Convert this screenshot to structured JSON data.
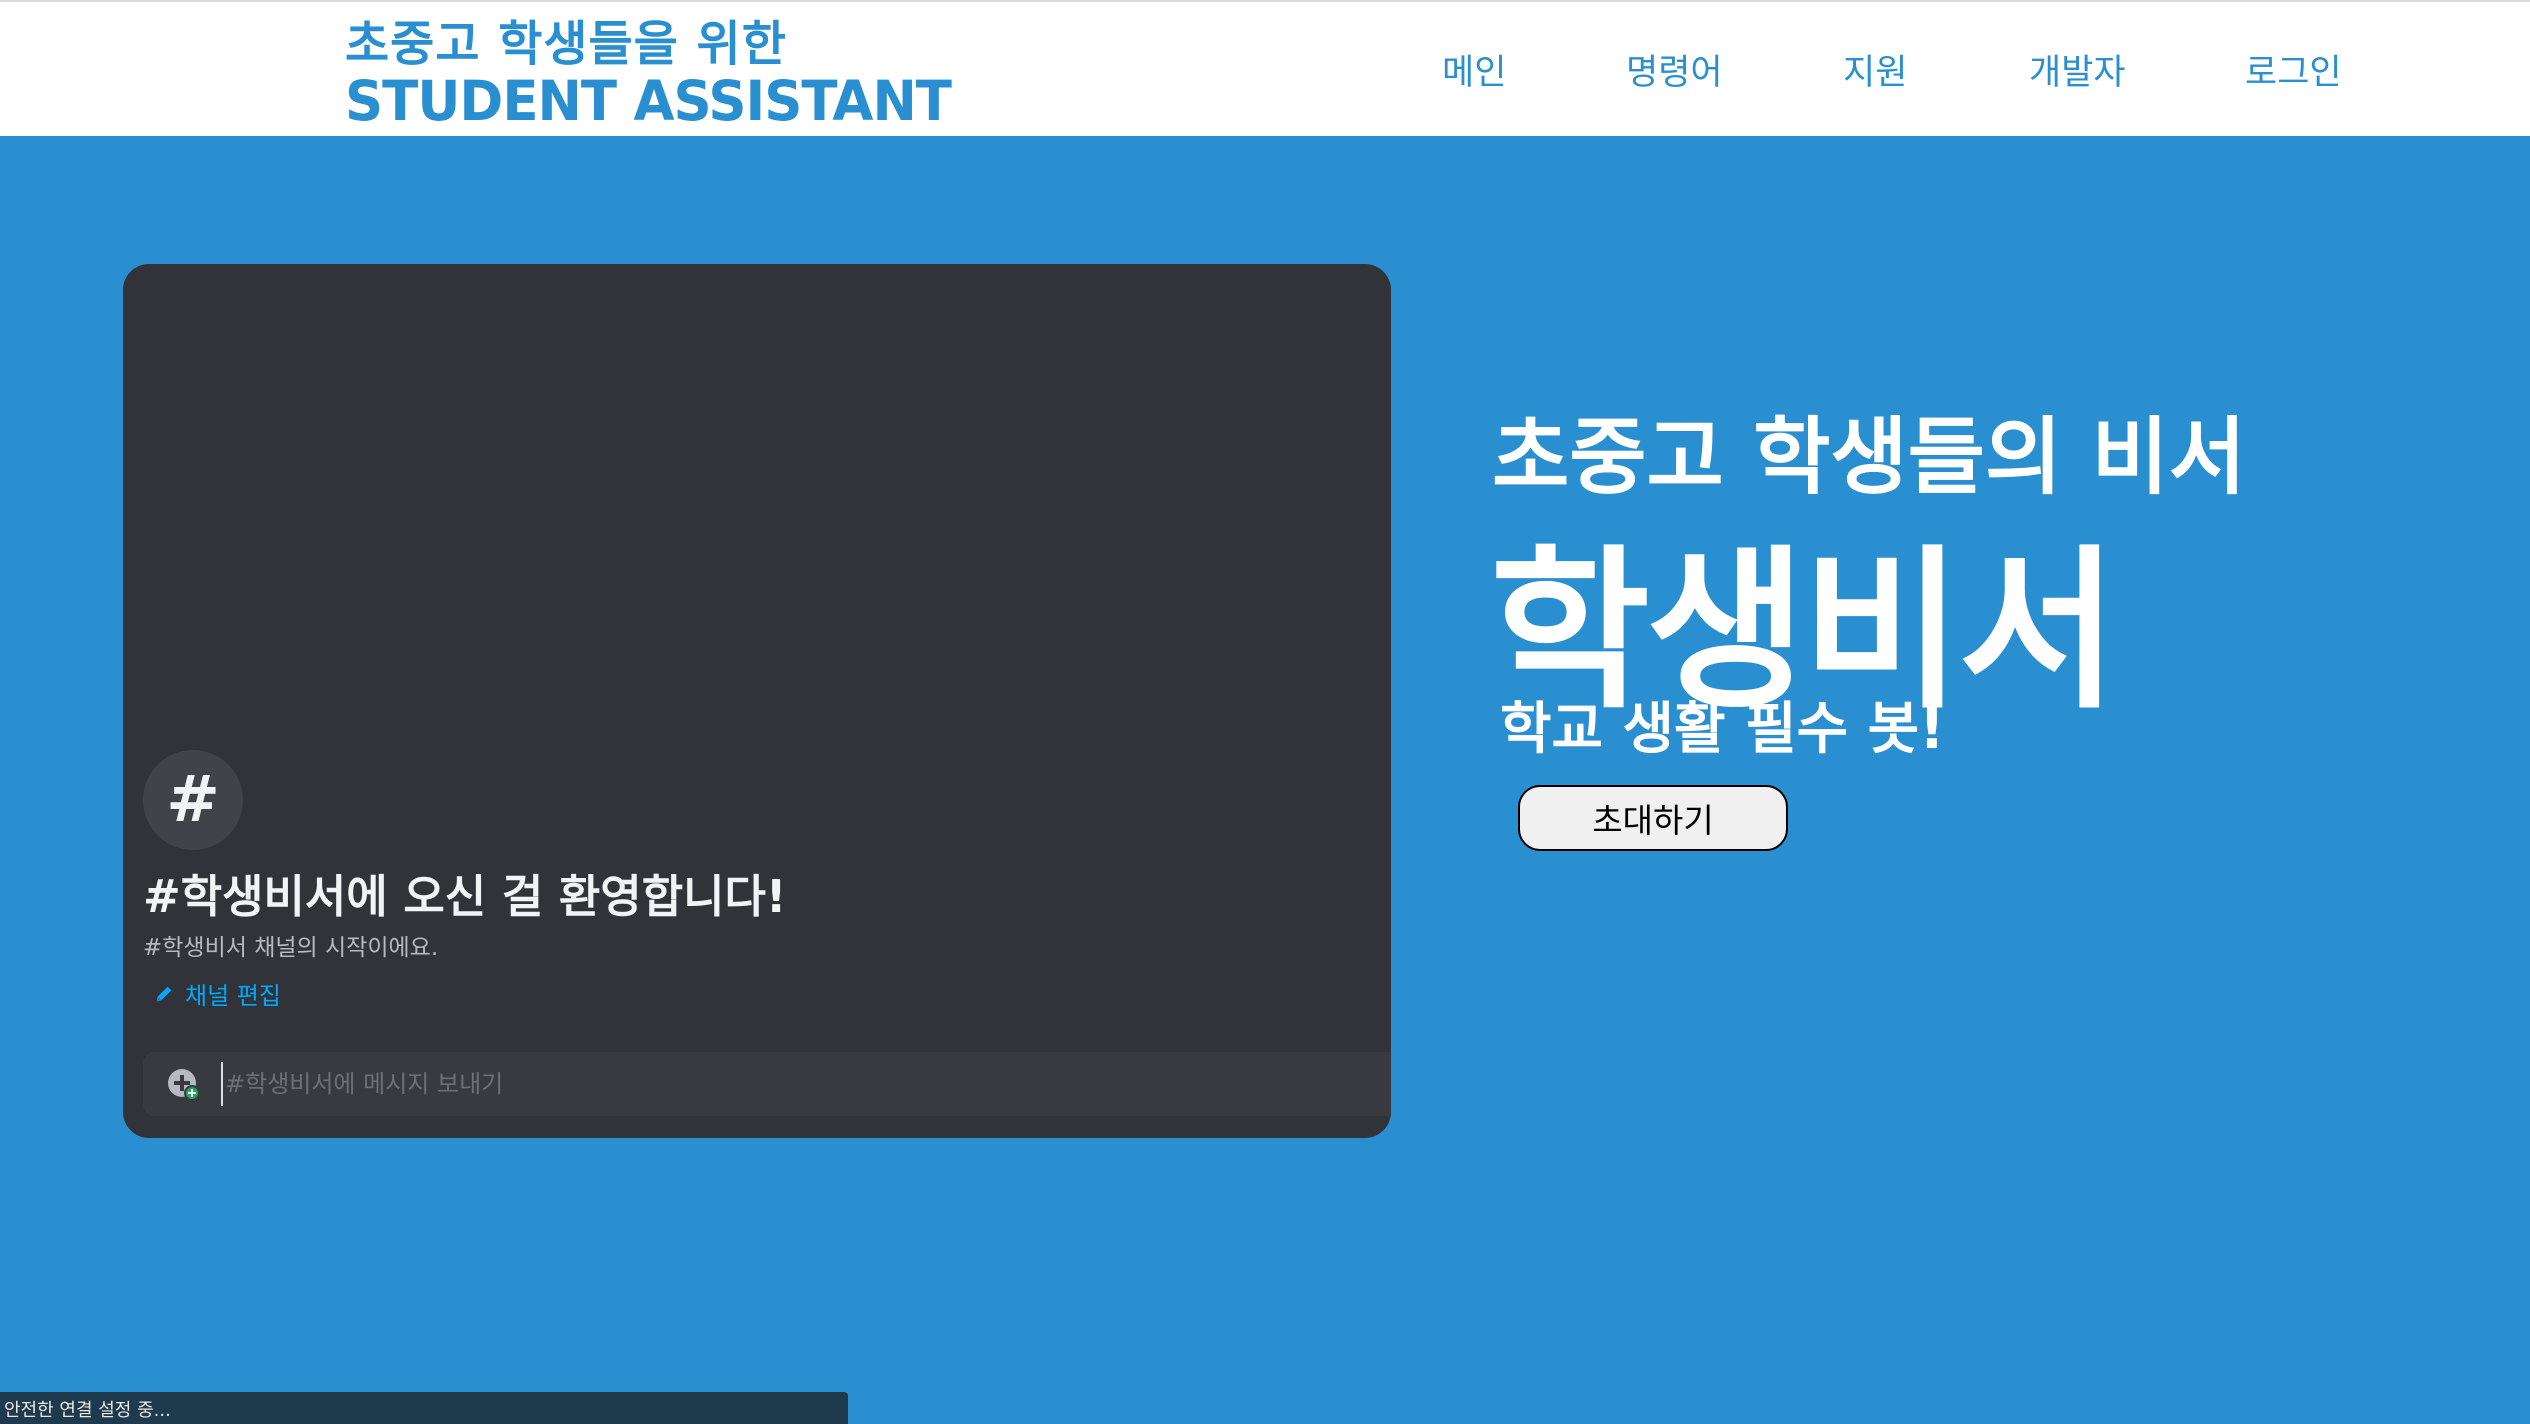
{
  "header": {
    "logo_line1": "초중고 학생들을 위한",
    "logo_line2": "STUDENT ASSISTANT",
    "nav": [
      {
        "label": "메인"
      },
      {
        "label": "명령어"
      },
      {
        "label": "지원"
      },
      {
        "label": "개발자"
      },
      {
        "label": "로그인"
      }
    ]
  },
  "discord_panel": {
    "channel_icon": "#",
    "welcome_title": "#학생비서에 오신 걸 환영합니다!",
    "welcome_sub": "#학생비서 채널의 시작이에요.",
    "edit_channel_label": "채널 편집",
    "composer_placeholder": "#학생비서에 메시지 보내기",
    "icons": {
      "channel": "hash-icon",
      "edit": "pencil-icon",
      "add": "plus-circle-icon"
    }
  },
  "hero": {
    "subtitle": "초중고 학생들의 비서",
    "title": "학생비서",
    "tagline": "학교 생활 필수 봇!",
    "invite_button": "초대하기"
  },
  "status_bar": {
    "text": "안전한 연결 설정 중..."
  },
  "colors": {
    "brand_blue": "#2a8fd1",
    "panel_bg": "#313338",
    "composer_bg": "#383a40",
    "link_blue": "#00a8fc",
    "add_badge_green": "#23a55a"
  }
}
